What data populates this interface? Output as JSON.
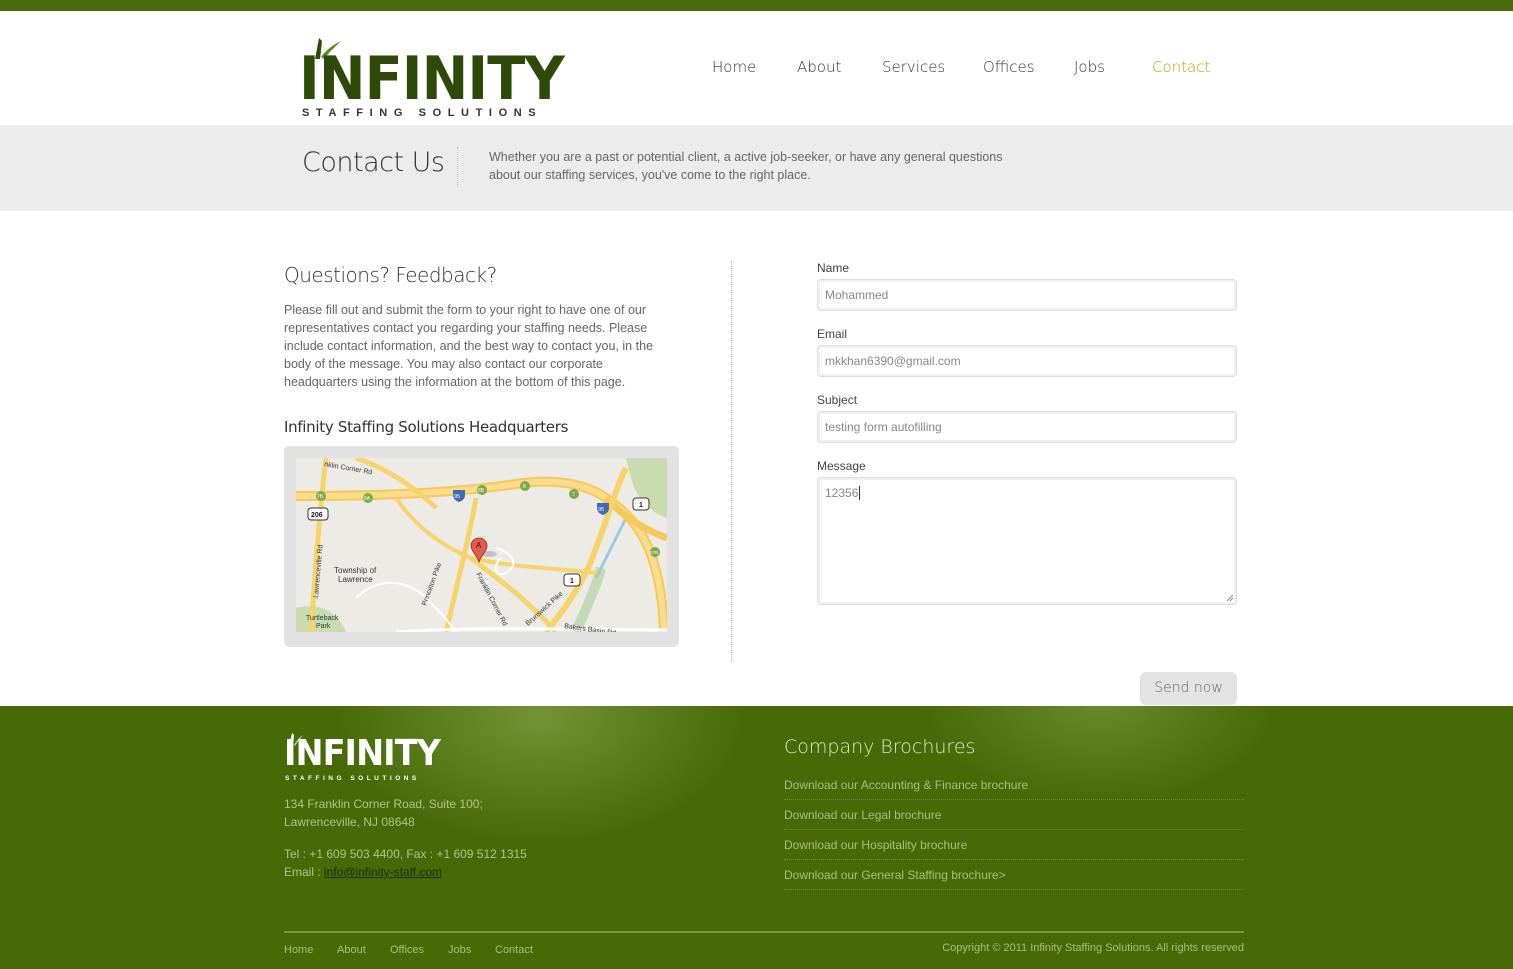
{
  "brand": {
    "name": "INFINITY",
    "tagline": "STAFFING SOLUTIONS",
    "primary_color": "#4a6a0e",
    "accent_color": "#c29a0c"
  },
  "nav": {
    "items": [
      {
        "label": "Home"
      },
      {
        "label": "About"
      },
      {
        "label": "Services"
      },
      {
        "label": "Offices"
      },
      {
        "label": "Jobs"
      },
      {
        "label": "Contact"
      }
    ],
    "active": "Contact"
  },
  "banner": {
    "title": "Contact Us",
    "text": "Whether you are a past or potential client, a active job-seeker, or have any general questions about our staffing services, you've come to the right place."
  },
  "left": {
    "heading": "Questions? Feedback?",
    "intro": "Please fill out and submit the form to your right to have one of our representatives contact you regarding your staffing needs. Please include contact information, and the best way to contact you, in the body of the message. You may also contact our corporate headquarters using the information at the bottom of this page.",
    "hq_heading": "Infinity Staffing Solutions Headquarters",
    "map": {
      "labels": {
        "franklin_corner_top": "nklin Corner Rd",
        "lawrenceville_rd": "Lawrenceville Rd",
        "township": "Township of",
        "township2": "Lawrence",
        "princeton_pike": "Princeton Pike",
        "franklin_corner_rd": "Franklin Corner Rd",
        "brunswick_pike": "Brunswick Pike",
        "bakers_basin": "Bakers Basin Rd",
        "turtleback": "Turtleback",
        "park": "Park",
        "marker": "A",
        "shield_206": "206",
        "shield_1a": "1",
        "shield_1b": "1",
        "shield_95a": "95",
        "shield_95b": "95",
        "exit_7b": "7B",
        "exit_8a": "8A",
        "exit_8b": "8B",
        "exit_7": "7",
        "exit_8": "8",
        "exit_67b": "67B"
      }
    }
  },
  "form": {
    "name_label": "Name",
    "name_value": "Mohammed",
    "email_label": "Email",
    "email_value": "mkkhan6390@gmail.com",
    "subject_label": "Subject",
    "subject_value": "testing form autofilling",
    "message_label": "Message",
    "message_value": "12356",
    "submit_label": "Send now"
  },
  "footer": {
    "address1": "134 Franklin Corner Road, Suite 100;",
    "address2": "Lawrenceville, NJ 08648",
    "phone": "Tel : +1 609 503 4400, Fax : +1 609 512 1315",
    "email_prefix": "Email : ",
    "email": "info@infinity-staff.com",
    "brochures_title": "Company Brochures",
    "brochures": [
      {
        "label": "Download our Accounting & Finance brochure"
      },
      {
        "label": "Download our Legal brochure"
      },
      {
        "label": "Download our Hospitality brochure"
      },
      {
        "label": "Download our General Staffing brochure>"
      }
    ],
    "nav": [
      {
        "label": "Home"
      },
      {
        "label": "About"
      },
      {
        "label": "Offices"
      },
      {
        "label": "Jobs"
      },
      {
        "label": "Contact"
      }
    ],
    "copyright": "Copyright © 2011 Infinity Staffing Solutions. All rights reserved"
  }
}
